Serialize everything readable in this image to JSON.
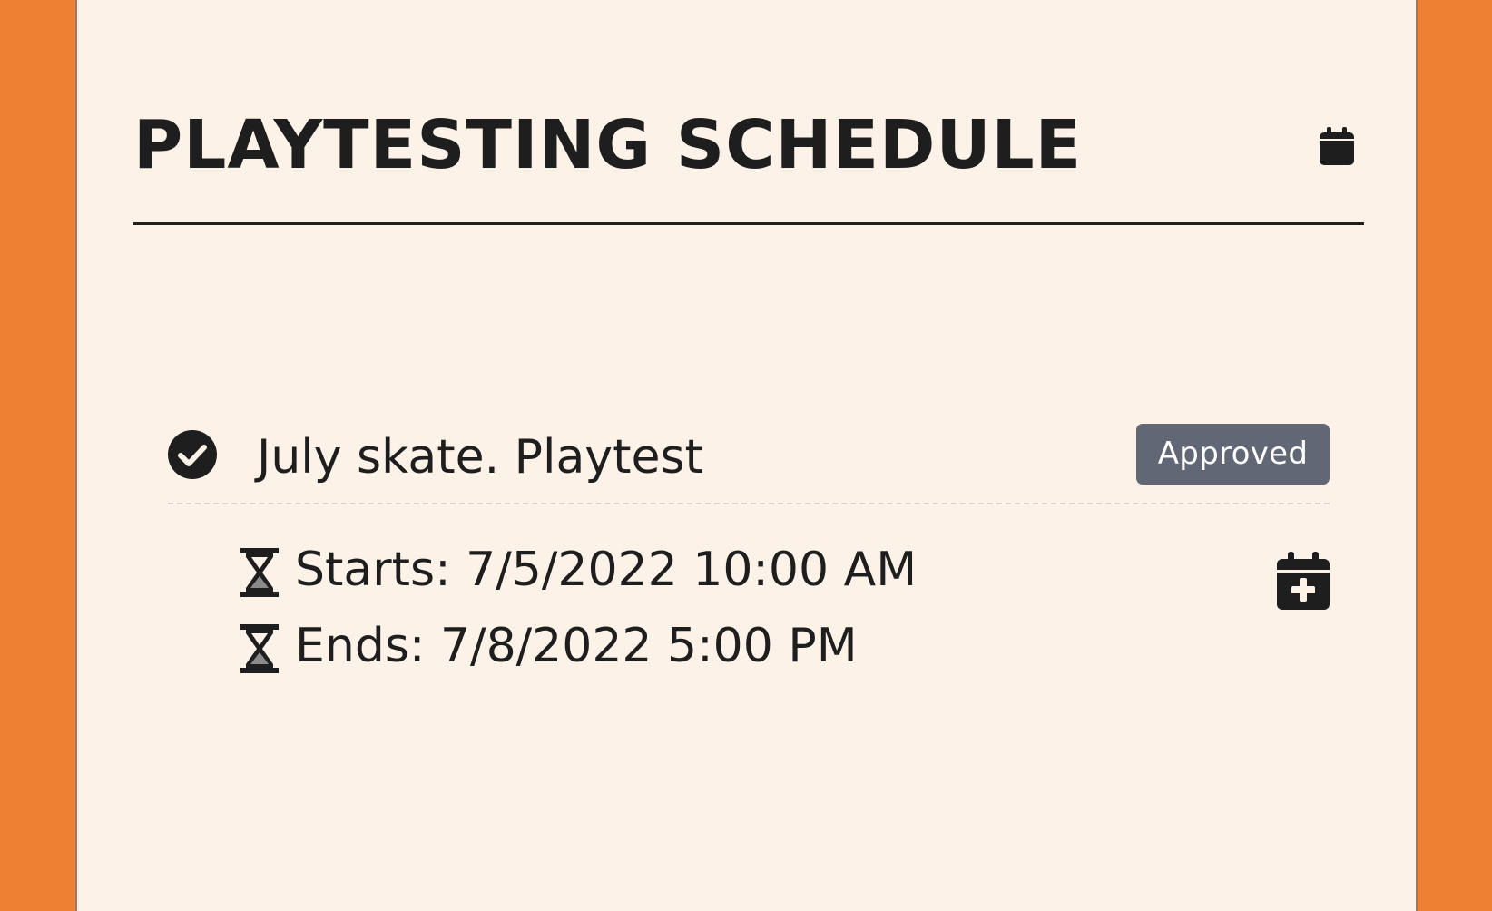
{
  "page": {
    "title": "PLAYTESTING SCHEDULE"
  },
  "colors": {
    "background": "#ED8033",
    "panel": "#FCF2E8",
    "text": "#1E1E1E",
    "badge": "#626775"
  },
  "icons": {
    "header": "calendar-icon",
    "status": "check-circle-icon",
    "time": "hourglass-icon",
    "action": "calendar-plus-icon"
  },
  "event": {
    "title": "July skate. Playtest",
    "status": "Approved",
    "starts": "Starts: 7/5/2022 10:00 AM",
    "ends": "Ends: 7/8/2022 5:00 PM"
  }
}
